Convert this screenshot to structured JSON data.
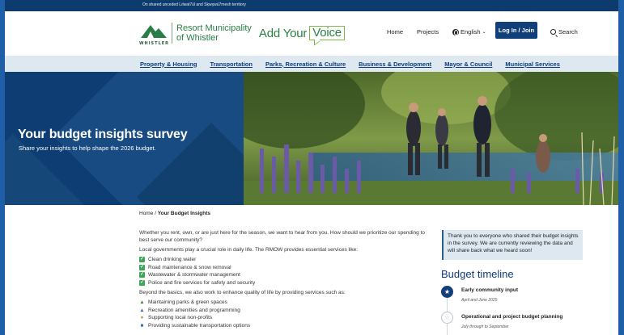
{
  "topbar": {
    "text": "On shared unceded Lılwat7úl and Sḵwx̱wú7mesh territory"
  },
  "header": {
    "logo_word": "WHISTLER",
    "logo_line1": "Resort Municipality",
    "logo_line2": "of Whistler",
    "brand_prefix": "Add Your",
    "brand_boxed": "Voice",
    "nav": {
      "home": "Home",
      "projects": "Projects",
      "language": "English",
      "login": "Log In / Join",
      "search": "Search"
    }
  },
  "categories": [
    "Property & Housing",
    "Transportation",
    "Parks, Recreation & Culture",
    "Business & Development",
    "Mayor & Council",
    "Municipal Services"
  ],
  "hero": {
    "title": "Your budget insights survey",
    "subtitle": "Share your insights to help shape the 2026 budget."
  },
  "breadcrumb": {
    "home": "Home",
    "separator": "/",
    "current": "Your Budget Insights"
  },
  "main": {
    "intro": "Whether you rent, own, or are just here for the season, we want to hear from you. How should we prioritize our spending to best serve our community?",
    "services_intro": "Local governments play a crucial role in daily life. The RMOW provides essential services like:",
    "services": [
      "Clean drinking water",
      "Road maintenance & snow removal",
      "Wastewater & stormwater management",
      "Police and fire services for safety and security"
    ],
    "beyond_intro": "Beyond the basics, we also work to enhance quality of life by providing services such as:",
    "extras": [
      {
        "icon": "tree-icon",
        "label": "Maintaining parks & green spaces"
      },
      {
        "icon": "mountain-icon",
        "label": "Recreation amenities and programming"
      },
      {
        "icon": "handshake-icon",
        "label": "Supporting local non-profits"
      },
      {
        "icon": "bus-icon",
        "label": "Providing sustainable transportation options"
      }
    ]
  },
  "sidebar": {
    "note": "Thank you to everyone who shared their budget insights in the survey. We are currently reviewing the data and will share back what we heard soon!",
    "timeline_title": "Budget timeline",
    "steps": [
      {
        "title": "Early community input",
        "date": "April and June 2025",
        "status": "active"
      },
      {
        "title": "Operational and project budget planning",
        "date": "July through to September",
        "status": "pending"
      }
    ]
  },
  "colors": {
    "navy": "#103f7a",
    "green": "#2a7e45",
    "nav_bg": "#dde8f0",
    "frame_blue": "#1f5fa8"
  }
}
